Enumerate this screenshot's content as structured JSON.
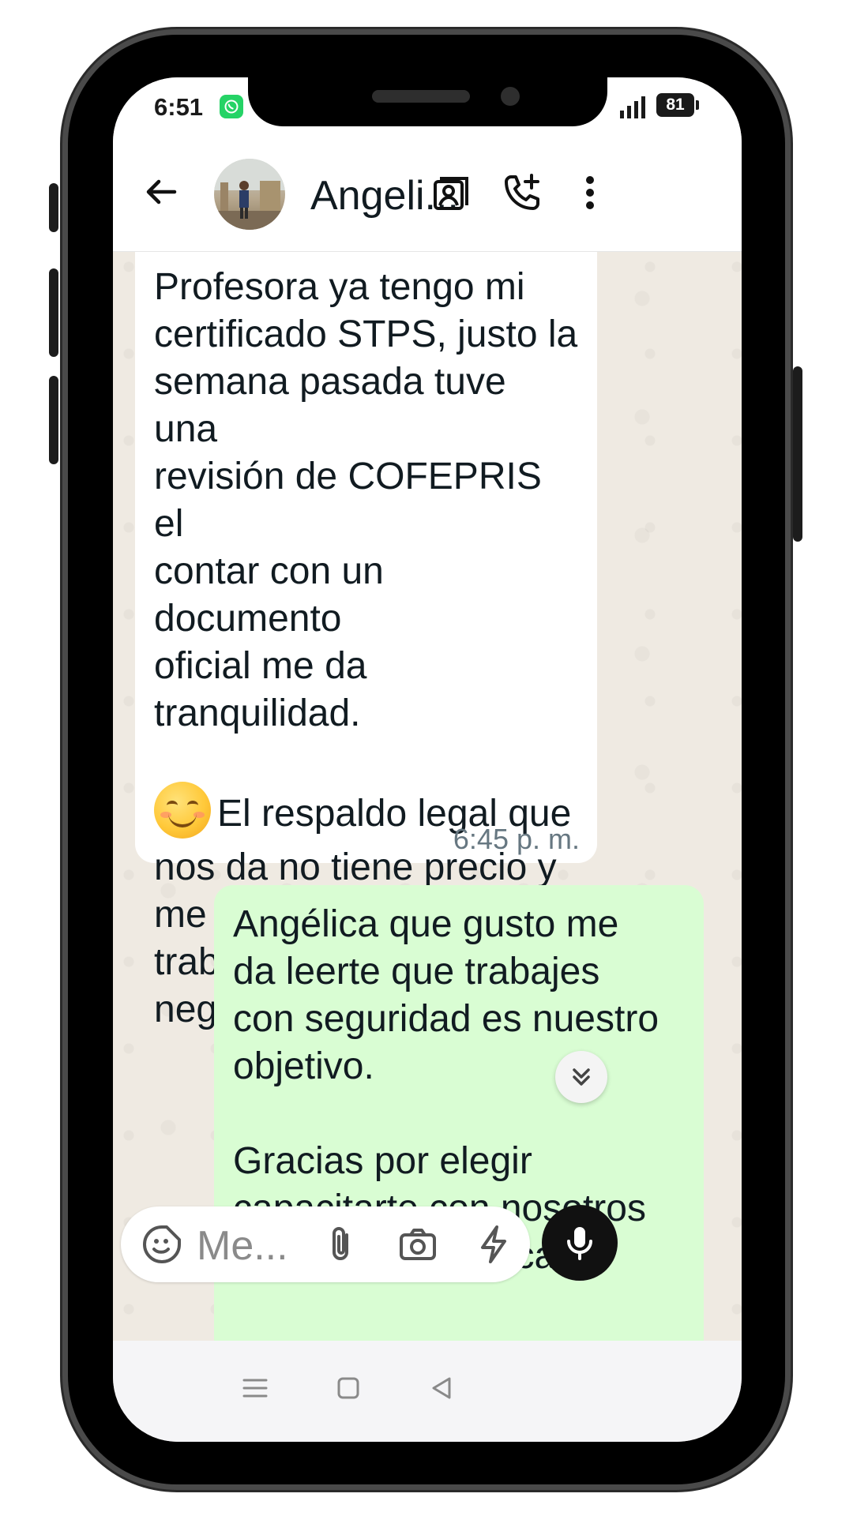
{
  "status_bar": {
    "time": "6:51",
    "battery": "81"
  },
  "header": {
    "contact_name": "Angeli..."
  },
  "messages": [
    {
      "direction": "incoming",
      "paragraph1": "Profesora ya tengo mi\ncertificado STPS, justo la\nsemana pasada tuve una\nrevisión de COFEPRIS el\ncontar con un documento\noficial me da tranquilidad.",
      "paragraph2_first_line": "El respaldo legal que",
      "paragraph2_rest": "nos da no tiene precio y\nme da tranquilidad para\ntrabajar dentro de mi\nnegocio.",
      "time": "6:45 p. m."
    },
    {
      "direction": "outgoing",
      "text": "Angélica que gusto me\nda leerte que trabajes\ncon seguridad es nuestro\nobjetivo.\n\nGracias por elegir\ncapacitarte con nosotros\ny poner en práctica lo"
    }
  ],
  "composer": {
    "placeholder": "Me..."
  },
  "colors": {
    "incoming_bubble": "#ffffff",
    "outgoing_bubble": "#d9fdd3",
    "chat_background": "#efeae2",
    "whatsapp_green": "#25d366"
  }
}
